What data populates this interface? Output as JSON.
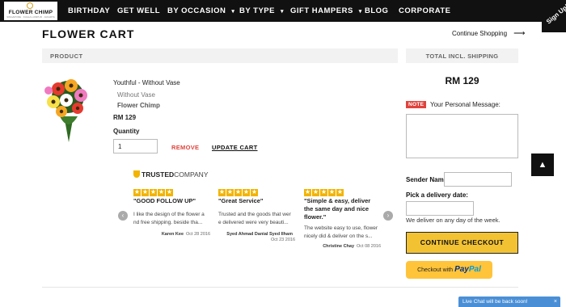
{
  "header": {
    "logo": {
      "name": "FLOWER CHIMP",
      "tagline": "SINGAPORE · KUALA LUMPUR · JAKARTA"
    },
    "nav": [
      {
        "label": "BIRTHDAY",
        "dropdown": false
      },
      {
        "label": "GET WELL",
        "dropdown": false
      },
      {
        "label": "BY OCCASION",
        "dropdown": true
      },
      {
        "label": "BY TYPE",
        "dropdown": true
      },
      {
        "label": "GIFT HAMPERS",
        "dropdown": true
      },
      {
        "label": "BLOG",
        "dropdown": false
      },
      {
        "label": "CORPORATE",
        "dropdown": false
      }
    ],
    "signup": "Sign Up!"
  },
  "cart": {
    "title": "FLOWER CART",
    "continue_shopping": "Continue Shopping",
    "product_header": "PRODUCT",
    "total_header": "TOTAL INCL. SHIPPING",
    "item": {
      "name": "Youthful - Without Vase",
      "variant": "Without Vase",
      "brand": "Flower Chimp",
      "price": "RM 129",
      "quantity_label": "Quantity",
      "quantity": "1",
      "remove": "REMOVE",
      "update": "UPDATE CART"
    },
    "total": "RM 129"
  },
  "reviews": {
    "brand": "TRUSTED",
    "brand_suffix": "COMPANY",
    "prev_icon": "chevron-left-icon",
    "next_icon": "chevron-right-icon",
    "items": [
      {
        "stars": 5,
        "title": "\"GOOD FOLLOW UP\"",
        "body": "I like the design of the flower a nd free shipping. beside tha...",
        "author": "Karen Kee",
        "date": "Oct 28 2016"
      },
      {
        "stars": 5,
        "title": "\"Great Service\"",
        "body": "Trusted and the goods that wer e delivered were very beauti...",
        "author": "Syed Ahmad Danial Syed Ilham",
        "date": "Oct 23 2016"
      },
      {
        "stars": 5,
        "title": "\"Simple & easy, deliver the same day and nice flower.\"",
        "body": "The website easy to use, flower nicely did & deliver on the s...",
        "author": "Christine Chay",
        "date": "Oct 08 2016"
      }
    ]
  },
  "sidebar": {
    "note_badge": "NOTE",
    "message_label": "Your Personal Message:",
    "sender_label": "Sender Name",
    "delivery_label": "Pick a delivery date:",
    "delivery_note": "We deliver on any day of the week.",
    "checkout": "CONTINUE CHECKOUT",
    "paypal_prefix": "Checkout with",
    "paypal_brand_1": "Pay",
    "paypal_brand_2": "Pal"
  },
  "widgets": {
    "scroll_top": "▲",
    "live_chat": "Live Chat will be back soon!",
    "live_chat_close": "×"
  },
  "colors": {
    "nav_bg": "#111111",
    "accent_yellow": "#f2c233",
    "paypal_yellow": "#ffc439",
    "star_color": "#f2b400",
    "remove_red": "#e0433c",
    "chat_blue": "#4a8fd6"
  }
}
